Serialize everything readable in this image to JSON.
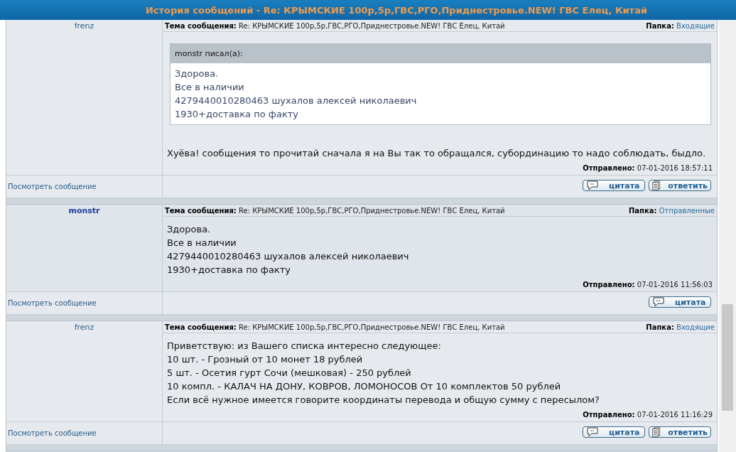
{
  "window": {
    "title": "История сообщений - Re: КРЫМСКИЕ 100р,5р,ГВС,РГО,Приднестровье.NEW! ГВС Елец, Китай"
  },
  "messages": [
    {
      "author": "frenz",
      "author_bold": false,
      "subject_label": "Тема сообщения:",
      "subject": "Re: КРЫМСКИЕ 100р,5р,ГВС,РГО,Приднестровье.NEW! ГВС Елец, Китай",
      "folder_label": "Папка:",
      "folder": "Входящие",
      "quote": {
        "header": "monstr писал(а):",
        "lines": [
          "Здорова.",
          "Все в наличии",
          "4279440010280463 шухалов алексей николаевич",
          "1930+доставка по факту"
        ]
      },
      "lines": [
        "Хуёва! сообщения то прочитай сначала я на Вы так то обращался, субординацию то надо соблюдать, быдло."
      ],
      "sent_label": "Отправлено:",
      "sent": "07-01-2016 18:57:11",
      "view_link": "Посмотреть сообщение",
      "buttons": [
        {
          "kind": "quote",
          "label": "цитата"
        },
        {
          "kind": "reply",
          "label": "ответить"
        }
      ]
    },
    {
      "author": "monstr",
      "author_bold": true,
      "subject_label": "Тема сообщения:",
      "subject": "Re: КРЫМСКИЕ 100р,5р,ГВС,РГО,Приднестровье.NEW! ГВС Елец, Китай",
      "folder_label": "Папка:",
      "folder": "Отправленные",
      "lines": [
        "Здорова.",
        "Все в наличии",
        "4279440010280463 шухалов алексей николаевич",
        "1930+доставка по факту"
      ],
      "sent_label": "Отправлено:",
      "sent": "07-01-2016 11:56:03",
      "view_link": "Посмотреть сообщение",
      "buttons": [
        {
          "kind": "quote",
          "label": "цитата"
        }
      ]
    },
    {
      "author": "frenz",
      "author_bold": false,
      "subject_label": "Тема сообщения:",
      "subject": "Re: КРЫМСКИЕ 100р,5р,ГВС,РГО,Приднестровье.NEW! ГВС Елец, Китай",
      "folder_label": "Папка:",
      "folder": "Входящие",
      "lines": [
        "Приветствую: из Вашего списка интересно следующее:",
        "10 шт. - Грозный от 10 монет 18 рублей",
        "5 шт. - Осетия гурт Сочи (мешковая) - 250 рублей",
        "10 компл. - КАЛАЧ НА ДОНУ, КОВРОВ, ЛОМОНОСОВ От 10 комплектов 50 рублей",
        "Если всё нужное имеется говорите координаты перевода и общую сумму с пересылом?"
      ],
      "sent_label": "Отправлено:",
      "sent": "07-01-2016 11:16:29",
      "view_link": "Посмотреть сообщение",
      "buttons": [
        {
          "kind": "quote",
          "label": "цитата"
        },
        {
          "kind": "reply",
          "label": "ответить"
        }
      ]
    }
  ]
}
